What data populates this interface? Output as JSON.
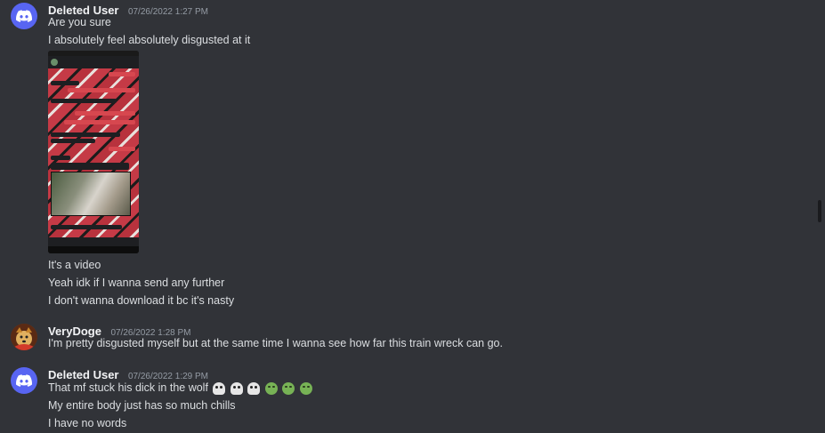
{
  "messages": [
    {
      "username": "Deleted User",
      "timestamp": "07/26/2022 1:27 PM",
      "avatar": "discord-icon",
      "lines": [
        "Are you sure",
        "I absolutely feel absolutely disgusted at it"
      ],
      "attachment": "phone-screenshot",
      "lines_after": [
        "It's a video",
        "Yeah idk if I wanna send any further",
        "I don't wanna download it bc it's nasty"
      ]
    },
    {
      "username": "VeryDoge",
      "timestamp": "07/26/2022 1:28 PM",
      "avatar": "doge-avatar",
      "lines": [
        "I'm pretty disgusted myself but at the same time I wanna see how far this train wreck can go."
      ]
    },
    {
      "username": "Deleted User",
      "timestamp": "07/26/2022 1:29 PM",
      "avatar": "discord-icon",
      "lines": [
        "That mf stuck his dick in the wolf",
        "My entire body just has so much chills",
        "I have no words"
      ],
      "emojis": [
        "skull-icon",
        "skull-icon",
        "skull-icon",
        "nauseated-face-icon",
        "nauseated-face-icon",
        "nauseated-face-icon"
      ]
    }
  ],
  "colors": {
    "background": "#313338",
    "text": "#dbdee1",
    "username": "#f2f3f5",
    "timestamp": "#949ba4",
    "discord_blurple": "#5865f2"
  }
}
